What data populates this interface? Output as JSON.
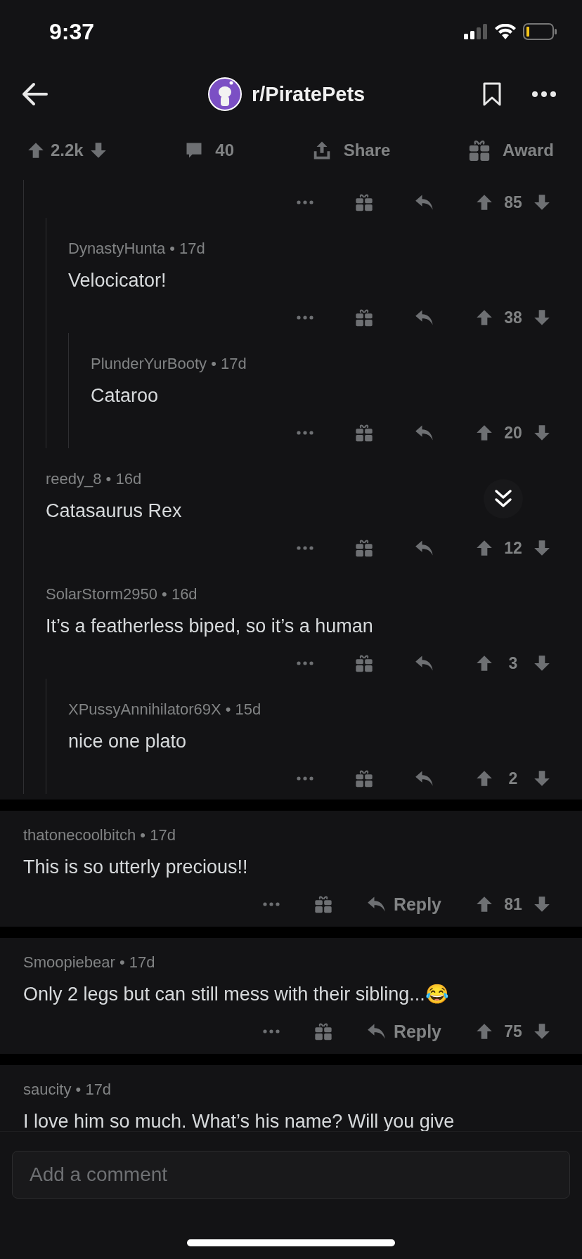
{
  "status_bar": {
    "time": "9:37"
  },
  "header": {
    "subreddit": "r/PiratePets"
  },
  "post_bar": {
    "score": "2.2k",
    "comments": "40",
    "share": "Share",
    "award": "Award"
  },
  "thread": {
    "comments": [
      {
        "score": "85",
        "children": [
          {
            "meta": "DynastyHunta • 17d",
            "body": "Velocicator!",
            "score": "38",
            "children": [
              {
                "meta": "PlunderYurBooty • 17d",
                "body": "Cataroo",
                "score": "20"
              }
            ]
          }
        ]
      },
      {
        "meta": "reedy_8 • 16d",
        "body": "Catasaurus Rex",
        "score": "12"
      },
      {
        "meta": "SolarStorm2950 • 16d",
        "body": "It’s a featherless biped, so it’s a human",
        "score": "3",
        "children": [
          {
            "meta": "XPussyAnnihilator69X • 15d",
            "body": "nice one plato",
            "score": "2"
          }
        ]
      }
    ]
  },
  "comments": [
    {
      "meta": "thatonecoolbitch • 17d",
      "body": "This is so utterly precious!!",
      "reply": "Reply",
      "score": "81"
    },
    {
      "meta": "Smoopiebear • 17d",
      "body": "Only 2 legs but can still mess with their sibling...😂",
      "reply": "Reply",
      "score": "75"
    },
    {
      "meta": "saucity • 17d",
      "body": "I love him so much. What’s his name? Will you give"
    }
  ],
  "composer": {
    "placeholder": "Add a comment"
  }
}
